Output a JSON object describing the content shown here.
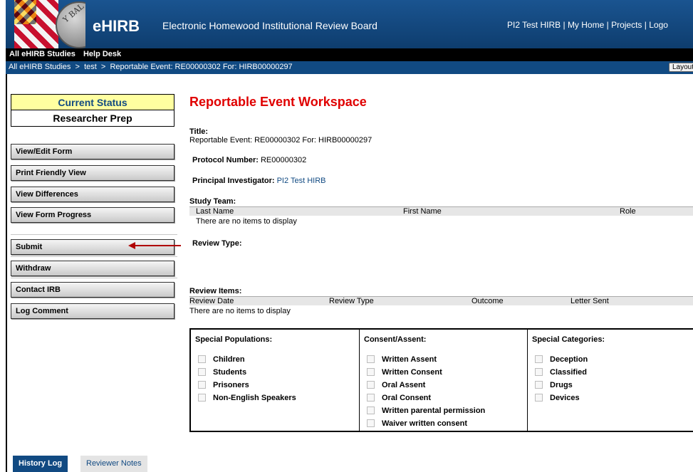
{
  "header": {
    "brand": "eHIRB",
    "subtitle": "Electronic Homewood Institutional Review Board",
    "user": "PI2 Test HIRB",
    "my_home": "My Home",
    "projects": "Projects",
    "logoff": "Logo",
    "seal_text": "Y BAL"
  },
  "nav": {
    "studies": "All eHIRB Studies",
    "help": "Help Desk"
  },
  "breadcrumb": {
    "text": "All eHIRB Studies  >  test  >  Reportable Event: RE00000302 For: HIRB00000297",
    "layout_button": "Layout"
  },
  "status": {
    "heading": "Current Status",
    "value": "Researcher Prep"
  },
  "actions": {
    "view_edit": "View/Edit Form",
    "print": "Print Friendly View",
    "differences": "View Differences",
    "progress": "View Form Progress",
    "submit": "Submit",
    "withdraw": "Withdraw",
    "contact": "Contact IRB",
    "log_comment": "Log Comment"
  },
  "workspace": {
    "title": "Reportable Event Workspace",
    "title_label": "Title:",
    "title_value": "Reportable Event: RE00000302 For: HIRB00000297",
    "protocol_label": "Protocol Number:",
    "protocol_value": "RE00000302",
    "pi_label": "Principal Investigator:",
    "pi_value": "PI2 Test HIRB",
    "study_team_label": "Study Team:",
    "study_team_cols": [
      "Last Name",
      "First Name",
      "Role"
    ],
    "study_team_empty": "There are no items to display",
    "review_type_label": "Review Type:",
    "review_items_label": "Review Items:",
    "review_items_cols": [
      "Review Date",
      "Review Type",
      "Outcome",
      "Letter Sent"
    ],
    "review_items_empty": "There are no items to display"
  },
  "categories": {
    "populations": {
      "title": "Special Populations:",
      "items": [
        "Children",
        "Students",
        "Prisoners",
        "Non-English Speakers"
      ]
    },
    "consent": {
      "title": "Consent/Assent:",
      "items": [
        "Written Assent",
        "Written Consent",
        "Oral Assent",
        "Oral Consent",
        "Written parental permission",
        "Waiver written consent"
      ]
    },
    "special": {
      "title": "Special Categories:",
      "items": [
        "Deception",
        "Classified",
        "Drugs",
        "Devices"
      ]
    }
  },
  "tabs": {
    "history": "History Log",
    "reviewer": "Reviewer Notes"
  },
  "colors": {
    "header_blue": "#114a82",
    "title_red": "#e00000",
    "status_yellow": "#ffffa0",
    "arrow_red": "#b00000"
  }
}
